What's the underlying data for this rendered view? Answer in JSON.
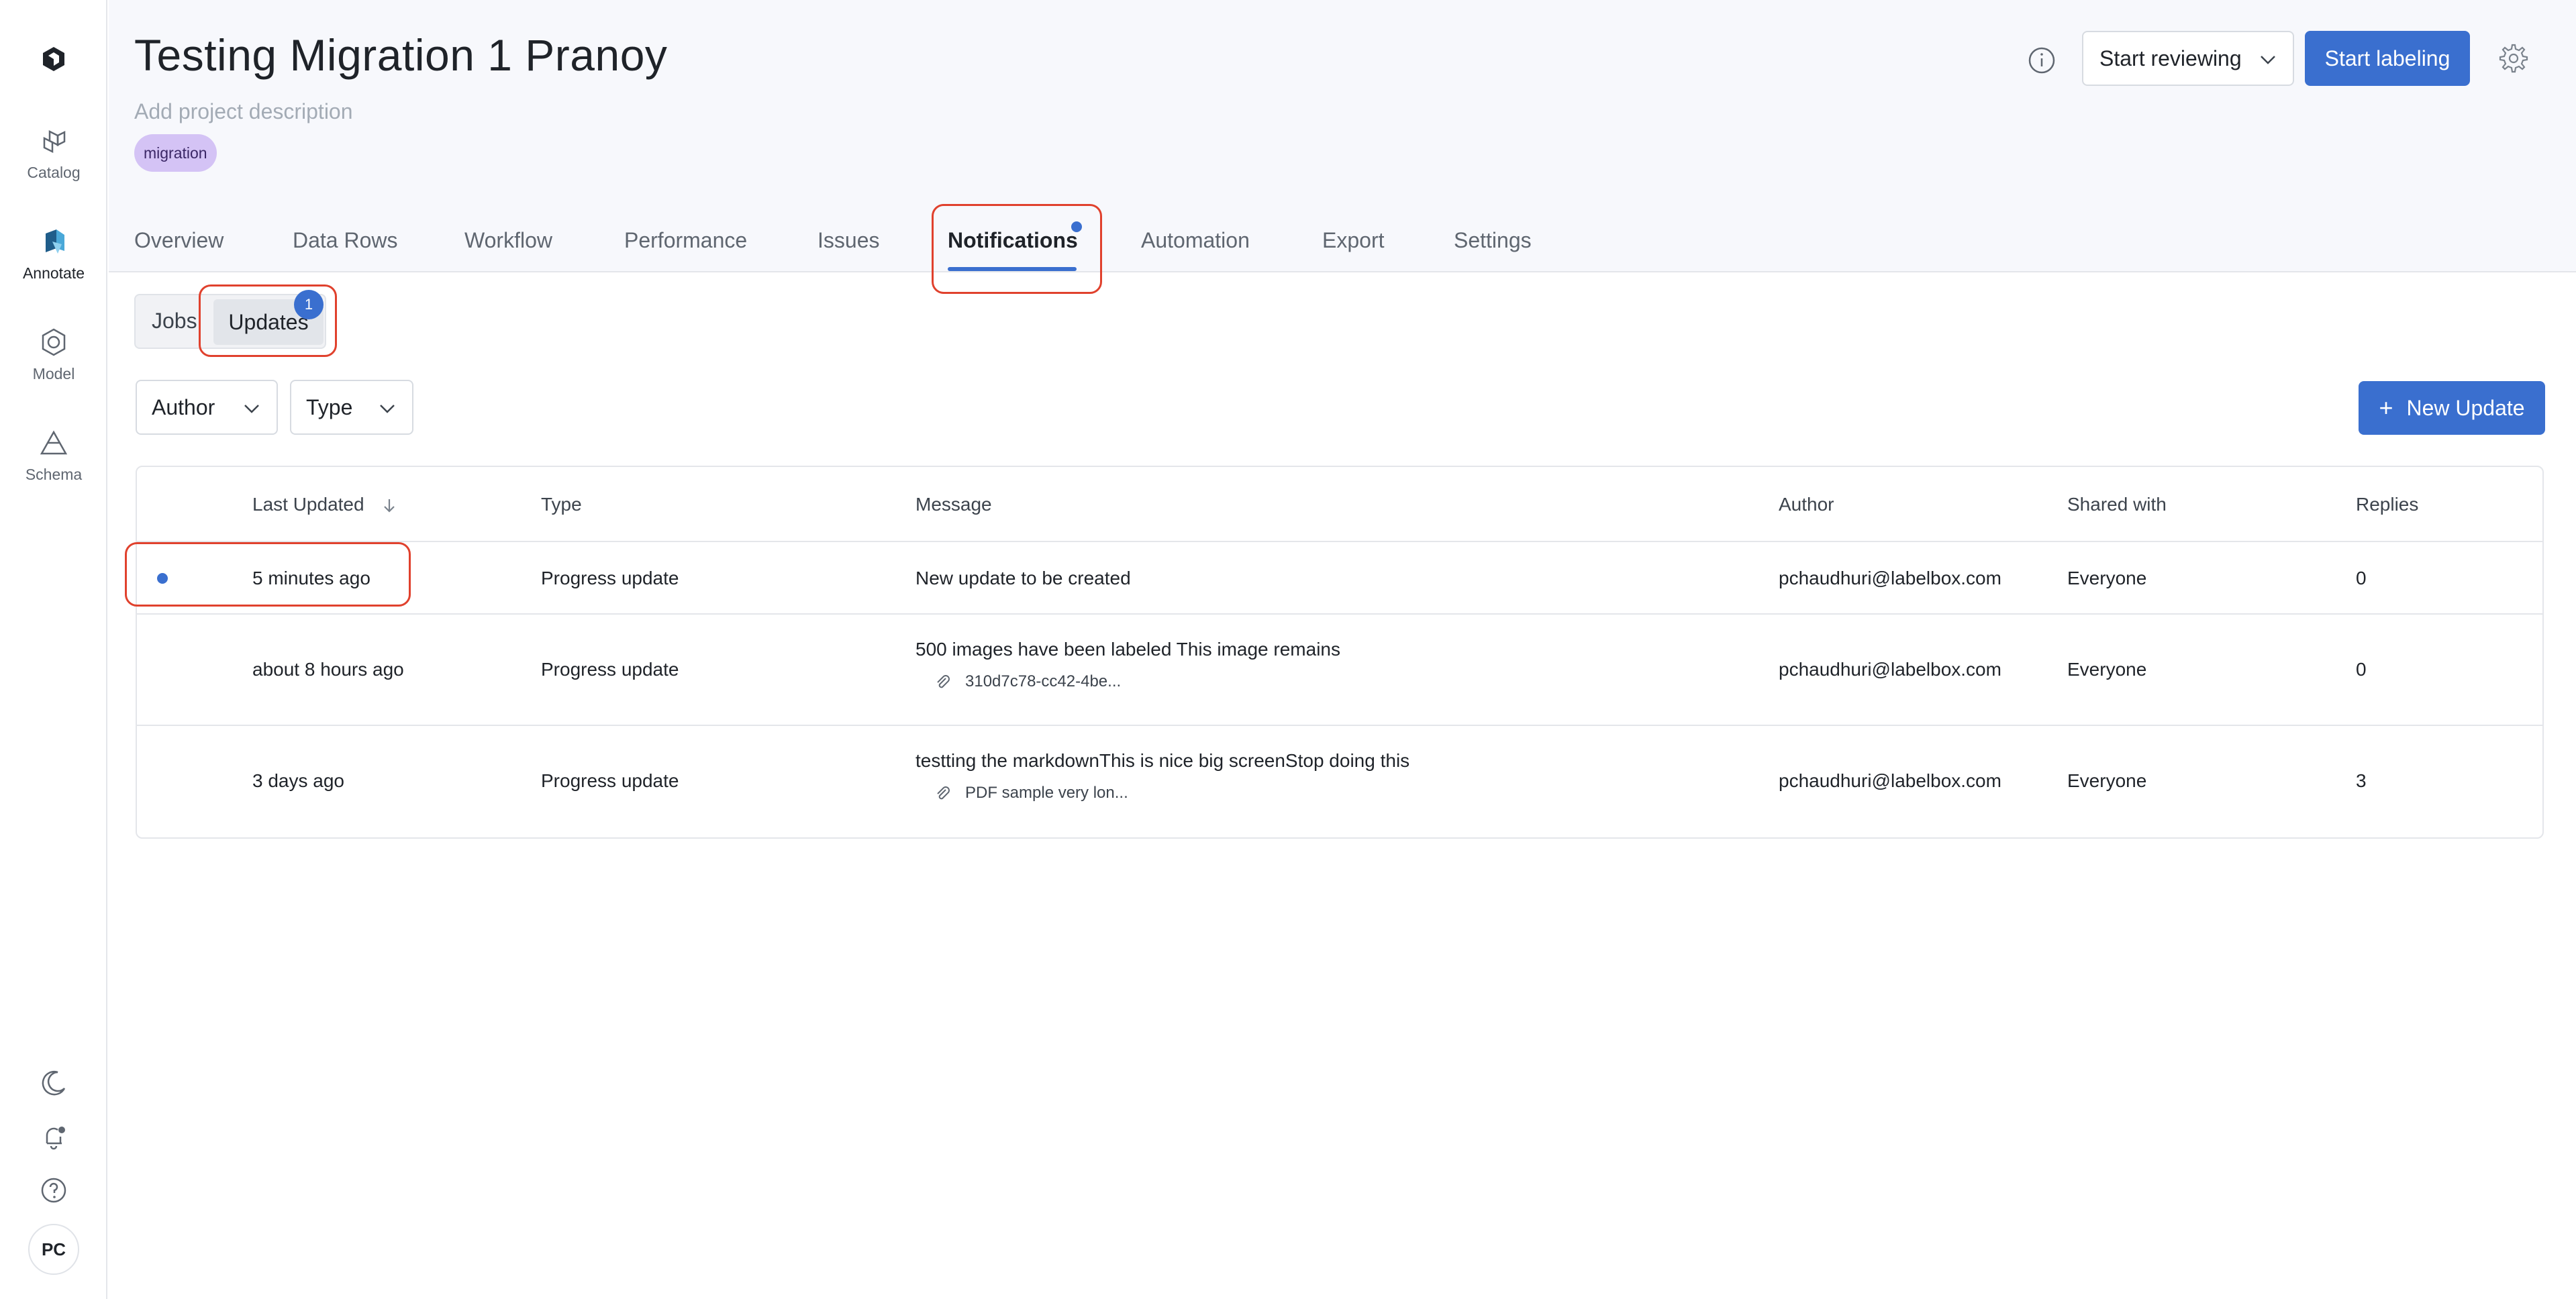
{
  "rail": {
    "items": [
      {
        "label": "Catalog",
        "icon": "catalog-icon"
      },
      {
        "label": "Annotate",
        "icon": "annotate-icon"
      },
      {
        "label": "Model",
        "icon": "model-icon"
      },
      {
        "label": "Schema",
        "icon": "schema-icon"
      }
    ],
    "avatar_initials": "PC",
    "active_color": "#4aa8d8"
  },
  "header": {
    "title": "Testing Migration 1 Pranoy",
    "description_placeholder": "Add project description",
    "tag": "migration",
    "review_button": "Start reviewing",
    "label_button": "Start labeling"
  },
  "tabs": [
    {
      "label": "Overview"
    },
    {
      "label": "Data Rows"
    },
    {
      "label": "Workflow"
    },
    {
      "label": "Performance"
    },
    {
      "label": "Issues"
    },
    {
      "label": "Notifications",
      "active": true
    },
    {
      "label": "Automation"
    },
    {
      "label": "Export"
    },
    {
      "label": "Settings"
    }
  ],
  "subtabs": {
    "jobs": "Jobs",
    "updates": "Updates",
    "updates_badge": "1"
  },
  "filters": {
    "author": "Author",
    "type": "Type",
    "new_update": "New Update"
  },
  "table": {
    "columns": {
      "last_updated": "Last Updated",
      "type": "Type",
      "message": "Message",
      "author": "Author",
      "shared_with": "Shared with",
      "replies": "Replies"
    },
    "rows": [
      {
        "unread": true,
        "last_updated": "5 minutes ago",
        "type": "Progress update",
        "message": "New update to be created",
        "attachment": "",
        "author": "pchaudhuri@labelbox.com",
        "shared_with": "Everyone",
        "replies": "0"
      },
      {
        "unread": false,
        "last_updated": "about 8 hours ago",
        "type": "Progress update",
        "message": "500 images have been labeled This image remains",
        "attachment": "310d7c78-cc42-4be...",
        "author": "pchaudhuri@labelbox.com",
        "shared_with": "Everyone",
        "replies": "0"
      },
      {
        "unread": false,
        "last_updated": "3 days ago",
        "type": "Progress update",
        "message": "testting the markdownThis is nice big screenStop doing this",
        "attachment": "PDF sample very lon...",
        "author": "pchaudhuri@labelbox.com",
        "shared_with": "Everyone",
        "replies": "3"
      }
    ]
  },
  "colors": {
    "primary": "#3a6fcf",
    "highlight": "#e0412d",
    "tag_bg": "#d4c3f5"
  }
}
